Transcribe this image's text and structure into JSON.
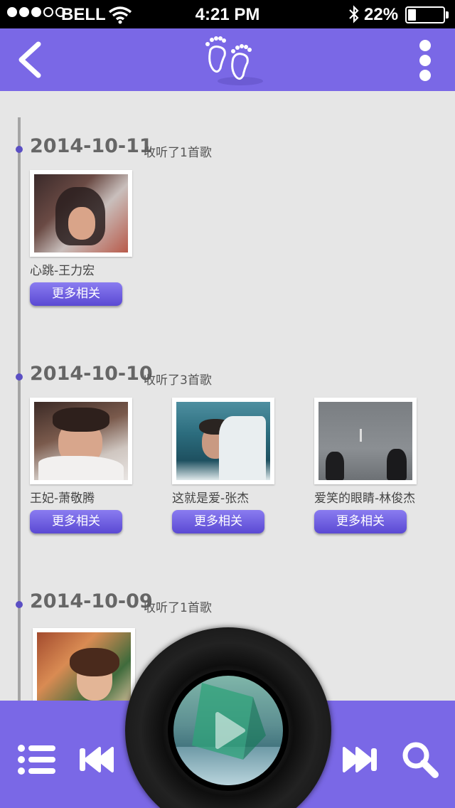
{
  "status_bar": {
    "carrier": "BELL",
    "time": "4:21 PM",
    "battery": "22%",
    "battery_level": 0.22,
    "signal_filled": 3,
    "signal_total": 5
  },
  "nav": {
    "back_icon": "chevron-left-icon",
    "logo_icon": "footprints-icon",
    "menu_icon": "vertical-dots-icon"
  },
  "history": [
    {
      "date": "2014-10-11",
      "summary": "收听了1首歌",
      "songs": [
        {
          "title": "心跳-王力宏",
          "more": "更多相关"
        }
      ]
    },
    {
      "date": "2014-10-10",
      "summary": "收听了3首歌",
      "songs": [
        {
          "title": "王妃-萧敬腾",
          "more": "更多相关"
        },
        {
          "title": "这就是爱-张杰",
          "more": "更多相关"
        },
        {
          "title": "爱笑的眼睛-林俊杰",
          "more": "更多相关"
        }
      ]
    },
    {
      "date": "2014-10-09",
      "summary": "收听了1首歌",
      "songs": [
        {
          "title": "",
          "more": ""
        }
      ]
    }
  ],
  "player": {
    "playlist_icon": "list-icon",
    "prev_icon": "skip-previous-icon",
    "play_icon": "play-icon",
    "next_icon": "skip-next-icon",
    "search_icon": "search-icon"
  },
  "colors": {
    "accent": "#7a68e6",
    "button": "#5a49d3",
    "background": "#e6e6e6"
  }
}
